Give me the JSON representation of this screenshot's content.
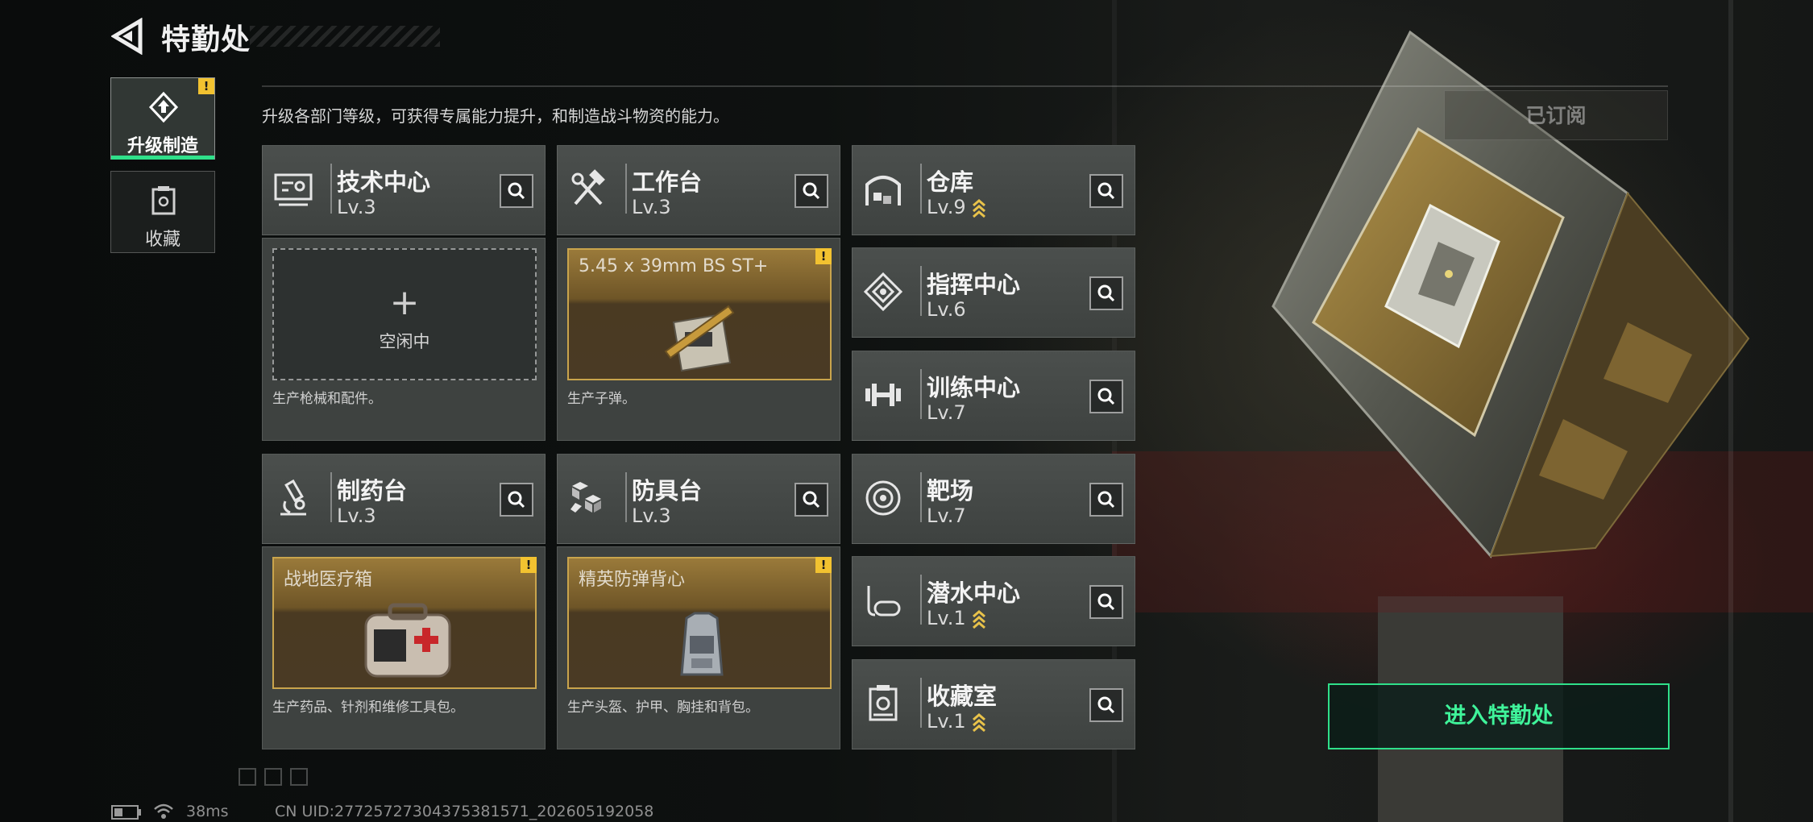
{
  "header": {
    "title": "特勤处",
    "description": "升级各部门等级，可获得专属能力提升，和制造战斗物资的能力。"
  },
  "sidebar": {
    "tabs": [
      {
        "label": "升级制造",
        "active": true,
        "icon": "upgrade-icon",
        "alert": true
      },
      {
        "label": "收藏",
        "active": false,
        "icon": "collection-icon",
        "alert": false
      }
    ]
  },
  "alert_badge": "!",
  "facilities": [
    {
      "key": "tech-center",
      "name": "技术中心",
      "level": "Lv.3",
      "icon": "circuit-monitor-icon",
      "upgradable": false
    },
    {
      "key": "workbench",
      "name": "工作台",
      "level": "Lv.3",
      "icon": "hammer-wrench-icon",
      "upgradable": false
    },
    {
      "key": "warehouse",
      "name": "仓库",
      "level": "Lv.9",
      "icon": "warehouse-icon",
      "upgradable": true
    },
    {
      "key": "command-center",
      "name": "指挥中心",
      "level": "Lv.6",
      "icon": "command-chip-icon",
      "upgradable": false
    },
    {
      "key": "training-center",
      "name": "训练中心",
      "level": "Lv.7",
      "icon": "dumbbell-icon",
      "upgradable": false
    },
    {
      "key": "pharmacy",
      "name": "制药台",
      "level": "Lv.3",
      "icon": "microscope-icon",
      "upgradable": false
    },
    {
      "key": "armor-bench",
      "name": "防具台",
      "level": "Lv.3",
      "icon": "cubes-icon",
      "upgradable": false
    },
    {
      "key": "shooting-range",
      "name": "靶场",
      "level": "Lv.7",
      "icon": "target-icon",
      "upgradable": false
    },
    {
      "key": "diving-center",
      "name": "潜水中心",
      "level": "Lv.1",
      "icon": "diving-mask-icon",
      "upgradable": true
    },
    {
      "key": "collection-room",
      "name": "收藏室",
      "level": "Lv.1",
      "icon": "collection-room-icon",
      "upgradable": true
    }
  ],
  "production": {
    "tech-center": {
      "state": "idle",
      "idle_label": "空闲中",
      "plus": "+",
      "description": "生产枪械和配件。"
    },
    "workbench": {
      "state": "producing",
      "item": "5.45 x 39mm BS ST+",
      "item_icon": "ammo-box-icon",
      "alert": true,
      "description": "生产子弹。"
    },
    "pharmacy": {
      "state": "producing",
      "item": "战地医疗箱",
      "item_icon": "medkit-icon",
      "alert": true,
      "description": "生产药品、针剂和维修工具包。"
    },
    "armor-bench": {
      "state": "producing",
      "item": "精英防弹背心",
      "item_icon": "vest-icon",
      "alert": true,
      "description": "生产头盔、护甲、胸挂和背包。"
    }
  },
  "right_panel": {
    "subscribed_label": "已订阅",
    "enter_label": "进入特勤处"
  },
  "status_bar": {
    "ping": "38ms",
    "uid": "CN UID:27725727304375381571_202605192058"
  },
  "colors": {
    "accent_green": "#2fe08a",
    "gold_border": "#c9a44c",
    "alert_yellow": "#f2c230",
    "card_bg": "#3e4240"
  }
}
